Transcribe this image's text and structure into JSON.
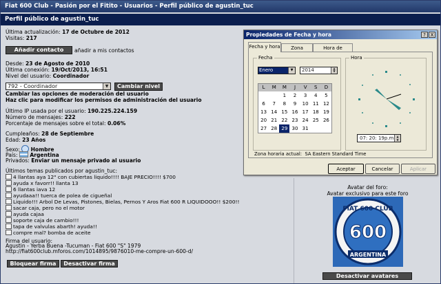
{
  "breadcrumb": "Fiat 600 Club - Pasión por el Fitito - Usuarios - Perfil público de agustin_tuc",
  "title": "Perfil público de agustin_tuc",
  "profile": {
    "last_update_label": "Última actualización:",
    "last_update_value": "17 de Octubre de 2012",
    "visits_label": "Visitas:",
    "visits_value": "217",
    "add_contact_button": "Añadir contacto",
    "add_contact_text": "añadir a mis contactos",
    "since_label": "Desde:",
    "since_value": "23 de Agosto de 2010",
    "last_conn_label": "Última conexión:",
    "last_conn_value": "19/Oct/2013, 16:51",
    "level_label": "Nivel del usuario:",
    "level_value": "Coordinador",
    "level_select": "792 - Coordinador",
    "change_level_button": "Cambiar nivel",
    "moderation_link": "Cambiar las opciones de moderación del usuario",
    "admin_link": "Haz clic para modificar los permisos de administración del usuario",
    "ip_label": "Último IP usada por el usuario:",
    "ip_value": "190.225.224.159",
    "messages_label": "Número de mensajes:",
    "messages_value": "222",
    "percent_label": "Porcentaje de mensajes sobre el total:",
    "percent_value": "0.06%",
    "birthday_label": "Cumpleaños:",
    "birthday_value": "28 de Septiembre",
    "age_label": "Edad:",
    "age_value": "23 Años",
    "sex_label": "Sexo:",
    "sex_value": "Hombre",
    "country_label": "País:",
    "country_value": "Argentina",
    "private_label": "Privados:",
    "private_value": "Enviar un mensaje privado al usuario",
    "topics_heading": "Últimos temas publicados por agustin_tuc:",
    "topics": [
      "4 llantas aya 12\" con cubiertas liquido!!!! BAJE PRECIO!!!! $700",
      "ayuda x favorr!! llanta 13",
      "6 llantas iava 12",
      "ayudaaa!! tuerca de polea de cigueñal",
      "Liquido!!! Arbol De Levas, Pistones, Bielas, Pernos Y Aros Fiat 600 R LIQUIDOOO!! $200!!",
      "sacar caja, pero no el motor",
      "ayuda cajaa",
      "soporte caja de cambio!!!",
      "tapa de valvulas abarth! ayuda!!",
      "compre mal? bomba de aceite"
    ],
    "signature_heading": "Firma del usuario:",
    "signature_line1": "Agustin - Yerba Buena -Tucuman - Fiat 600 \"S\" 1979",
    "signature_line2": "http://fiat600club.mforos.com/1014895/9876010-me-compre-un-600-d/",
    "block_signature_button": "Bloquear firma",
    "disable_signature_button": "Desactivar firma"
  },
  "avatar": {
    "heading": "Avatar del foro:",
    "subheading": "Avatar exclusivo para este foro",
    "logo_top": "FIAT 600 CLUB",
    "logo_center": "600",
    "logo_bottom": "ARGENTINA",
    "disable_button": "Desactivar avatares"
  },
  "dialog": {
    "title": "Propiedades de Fecha y hora",
    "help_btn": "?",
    "close_btn": "X",
    "tabs": [
      "Fecha y hora",
      "Zona horaria",
      "Hora de Internet"
    ],
    "date_group": "Fecha",
    "time_group": "Hora",
    "month": "Enero",
    "year": "2014",
    "weekdays": [
      "L",
      "M",
      "M",
      "J",
      "V",
      "S",
      "D"
    ],
    "calendar_rows": [
      [
        "",
        "",
        "1",
        "2",
        "3",
        "4",
        "5"
      ],
      [
        "6",
        "7",
        "8",
        "9",
        "10",
        "11",
        "12"
      ],
      [
        "13",
        "14",
        "15",
        "16",
        "17",
        "18",
        "19"
      ],
      [
        "20",
        "21",
        "22",
        "23",
        "24",
        "25",
        "26"
      ],
      [
        "27",
        "28",
        "29",
        "30",
        "31",
        "",
        ""
      ]
    ],
    "selected_day": "29",
    "time_value": "07: 20: 19p.m.",
    "timezone_label": "Zona horaria actual:",
    "timezone_value": "SA Eastern Standard Time",
    "ok_button": "Aceptar",
    "cancel_button": "Cancelar",
    "apply_button": "Aplicar"
  }
}
